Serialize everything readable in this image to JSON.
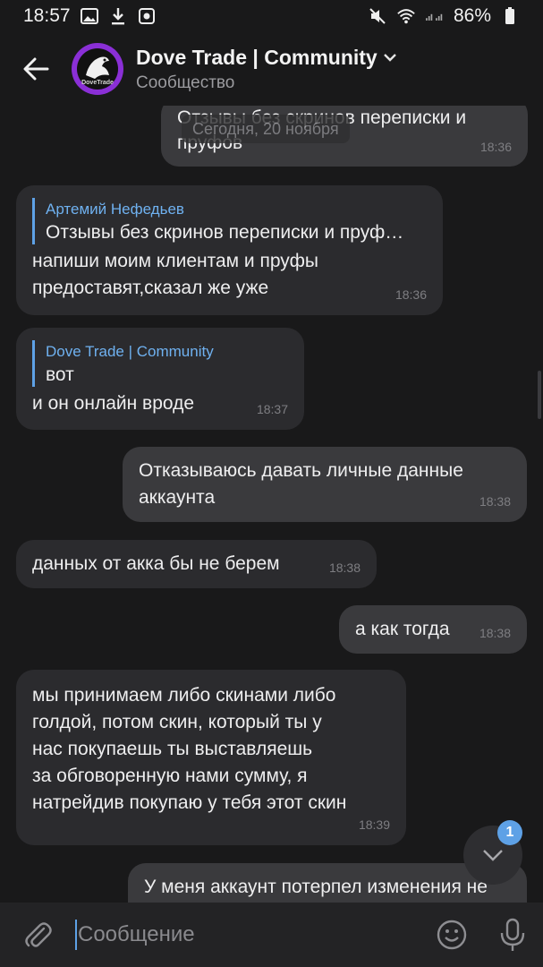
{
  "status_bar": {
    "time": "18:57",
    "battery": "86%"
  },
  "header": {
    "title": "Dove Trade | Community",
    "subtitle": "Сообщество",
    "avatar_brand": "DoveTrade"
  },
  "date_pill": "Сегодня, 20 ноября",
  "messages": [
    {
      "direction": "out",
      "text_lines": [
        "Отзывы без скринов переписки и",
        "пруфов"
      ],
      "time": "18:36"
    },
    {
      "direction": "in",
      "reply_name": "Артемий Нефедьев",
      "reply_text": "Отзывы без скринов переписки и пруф…",
      "text_lines": [
        "напиши моим клиентам и пруфы",
        "предоставят,сказал же уже"
      ],
      "time": "18:36"
    },
    {
      "direction": "in",
      "reply_name": "Dove Trade | Community",
      "reply_text": "вот",
      "text_lines": [
        "и он онлайн вроде"
      ],
      "time": "18:37"
    },
    {
      "direction": "out",
      "text_lines": [
        "Отказываюсь давать личные данные",
        "аккаунта"
      ],
      "time": "18:38"
    },
    {
      "direction": "in",
      "text_lines": [
        "данных от акка бы не берем"
      ],
      "time": "18:38"
    },
    {
      "direction": "out",
      "text_lines": [
        "а как тогда"
      ],
      "time": "18:38"
    },
    {
      "direction": "in",
      "text_lines": [
        "мы принимаем либо скинами либо",
        "голдой, потом скин, который ты у",
        "нас покупаешь ты выставляешь",
        "за обговоренную нами сумму, я",
        "натрейдив покупаю у тебя этот скин"
      ],
      "time": "18:39"
    },
    {
      "direction": "out",
      "text_lines": [
        "У меня аккаунт потерпел изменения не"
      ],
      "time": ""
    }
  ],
  "unread_count": "1",
  "input": {
    "placeholder": "Сообщение"
  },
  "colors": {
    "background": "#19191a",
    "bubble_in": "#2b2b2e",
    "bubble_out": "#3a3a3d",
    "accent": "#5ea1e6"
  },
  "icons": [
    "image-icon",
    "download-icon",
    "app-icon",
    "mute-icon",
    "wifi-icon",
    "signal-icon",
    "battery-icon",
    "back-arrow-icon",
    "chevron-down-icon",
    "attach-icon",
    "emoji-icon",
    "mic-icon",
    "scroll-down-icon"
  ]
}
